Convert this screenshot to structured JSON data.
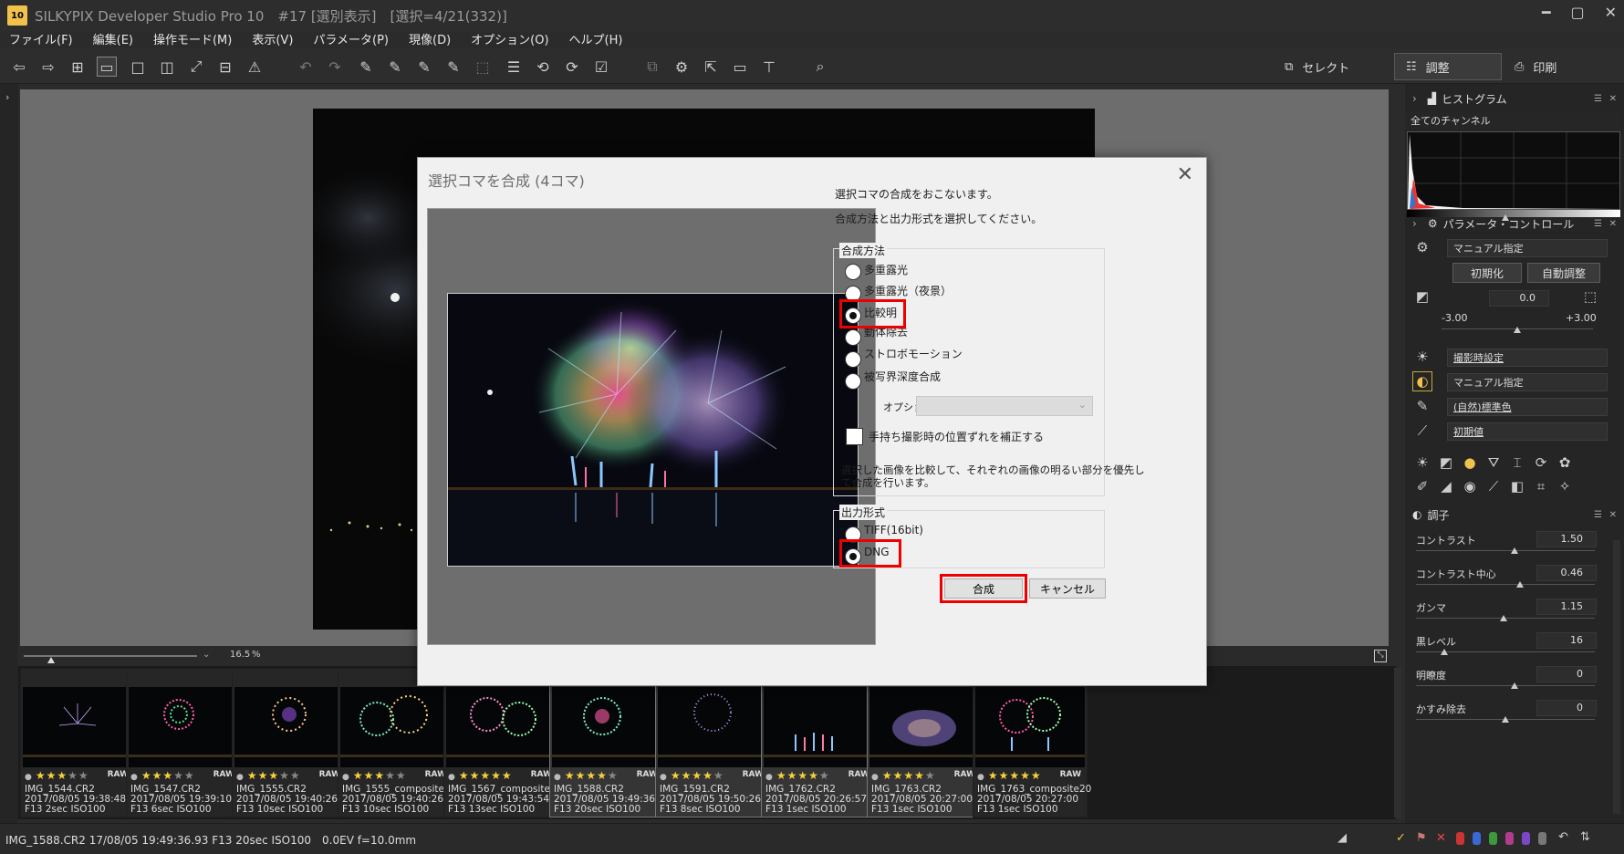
{
  "app": {
    "badge": "10",
    "title": "SILKYPIX Developer Studio Pro 10　#17 [選別表示]　[選択=4/21(332)]"
  },
  "menu": [
    "ファイル(F)",
    "編集(E)",
    "操作モード(M)",
    "表示(V)",
    "パラメータ(P)",
    "現像(D)",
    "オプション(O)",
    "ヘルプ(H)"
  ],
  "modes": {
    "select": "セレクト",
    "adjust": "調整",
    "print": "印刷"
  },
  "zoom": {
    "value": "16.5",
    "unit": "%"
  },
  "dialog": {
    "title": "選択コマを合成 (4コマ)",
    "intro1": "選択コマの合成をおこないます。",
    "intro2": "合成方法と出力形式を選択してください。",
    "method_label": "合成方法",
    "methods": [
      "多重露光",
      "多重露光（夜景）",
      "比較明",
      "動体除去",
      "ストロボモーション",
      "被写界深度合成"
    ],
    "selected_method": "比較明",
    "option_label": "オプション",
    "option_value": "",
    "align_checkbox": "手持ち撮影時の位置ずれを補正する",
    "align_checked": false,
    "description_line1": "選択した画像を比較して、それぞれの画像の明るい部分を優先し",
    "description_line2": "て合成を行います。",
    "output_label": "出力形式",
    "outputs": [
      "TIFF(16bit)",
      "DNG"
    ],
    "selected_output": "DNG",
    "ok": "合成",
    "cancel": "キャンセル"
  },
  "thumbnails": [
    {
      "name": "IMG_1544.CR2",
      "date": "2017/08/05 19:38:48",
      "exif": "F13 2sec ISO100",
      "stars": 3,
      "raw": "RAW",
      "selected": false
    },
    {
      "name": "IMG_1547.CR2",
      "date": "2017/08/05 19:39:10",
      "exif": "F13 6sec ISO100",
      "stars": 3,
      "raw": "RAW",
      "selected": false
    },
    {
      "name": "IMG_1555.CR2",
      "date": "2017/08/05 19:40:26",
      "exif": "F13 10sec ISO100",
      "stars": 3,
      "raw": "RAW",
      "selected": false
    },
    {
      "name": "IMG_1555_composite20",
      "date": "2017/08/05 19:40:26",
      "exif": "F13 10sec ISO100",
      "stars": 3,
      "raw": "RAW",
      "selected": false
    },
    {
      "name": "IMG_1567_composite20",
      "date": "2017/08/05 19:43:54",
      "exif": "F13 13sec ISO100",
      "stars": 5,
      "raw": "RAW",
      "selected": false
    },
    {
      "name": "IMG_1588.CR2",
      "date": "2017/08/05 19:49:36",
      "exif": "F13 20sec ISO100",
      "stars": 4,
      "raw": "RAW",
      "selected": true
    },
    {
      "name": "IMG_1591.CR2",
      "date": "2017/08/05 19:50:26",
      "exif": "F13 8sec ISO100",
      "stars": 4,
      "raw": "RAW",
      "selected": true
    },
    {
      "name": "IMG_1762.CR2",
      "date": "2017/08/05 20:26:57",
      "exif": "F13 1sec ISO100",
      "stars": 4,
      "raw": "RAW",
      "selected": true
    },
    {
      "name": "IMG_1763.CR2",
      "date": "2017/08/05 20:27:00",
      "exif": "F13 1sec ISO100",
      "stars": 4,
      "raw": "RAW",
      "selected": true
    },
    {
      "name": "IMG_1763_composite20",
      "date": "2017/08/05 20:27:00",
      "exif": "F13 1sec ISO100",
      "stars": 5,
      "raw": "RAW",
      "selected": false
    }
  ],
  "status": {
    "text": "IMG_1588.CR2 17/08/05 19:49:36.93 F13 20sec ISO100　0.0EV f=10.0mm"
  },
  "panel": {
    "histogram": {
      "title": "ヒストグラム",
      "channel": "全てのチャンネル"
    },
    "param": {
      "title": "パラメータ・コントロール",
      "preset": "マニュアル指定",
      "init": "初期化",
      "auto": "自動調整",
      "exposure": "0.0",
      "exp_min": "-3.00",
      "exp_max": "+3.00",
      "exposure_fraction": 0.5,
      "wb": "撮影時設定",
      "tone": "マニュアル指定",
      "color": "(自然)標準色",
      "sharp": "初期値"
    },
    "tone": {
      "title": "調子",
      "rows": [
        {
          "label": "コントラスト",
          "value": "1.50",
          "fraction": 0.55
        },
        {
          "label": "コントラスト中心",
          "value": "0.46",
          "fraction": 0.58
        },
        {
          "label": "ガンマ",
          "value": "1.15",
          "fraction": 0.49
        },
        {
          "label": "黒レベル",
          "value": "16",
          "fraction": 0.16
        },
        {
          "label": "明瞭度",
          "value": "0",
          "fraction": 0.55
        },
        {
          "label": "かすみ除去",
          "value": "0",
          "fraction": 0.5
        }
      ]
    }
  }
}
